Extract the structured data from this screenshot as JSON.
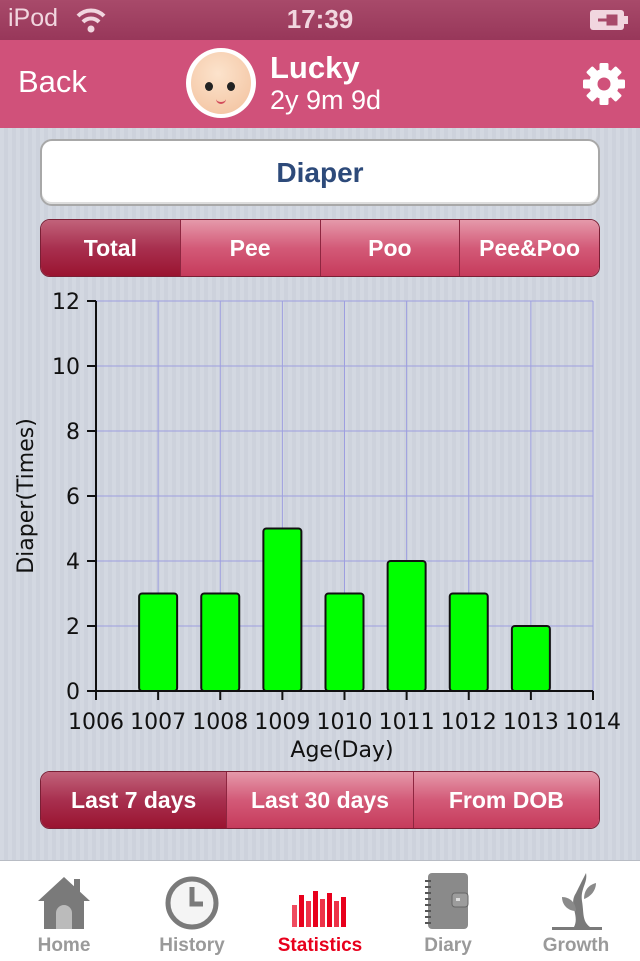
{
  "status_bar": {
    "carrier": "iPod",
    "time": "17:39",
    "wifi_icon": "wifi-icon",
    "battery_icon": "battery-charging-icon"
  },
  "nav": {
    "back_label": "Back",
    "baby_name": "Lucky",
    "baby_age": "2y 9m 9d",
    "avatar_icon": "baby-avatar",
    "settings_icon": "gear-icon"
  },
  "section_title": "Diaper",
  "type_tabs": [
    {
      "label": "Total",
      "active": true
    },
    {
      "label": "Pee",
      "active": false
    },
    {
      "label": "Poo",
      "active": false
    },
    {
      "label": "Pee&Poo",
      "active": false
    }
  ],
  "range_tabs": [
    {
      "label": "Last 7 days",
      "active": true
    },
    {
      "label": "Last 30 days",
      "active": false
    },
    {
      "label": "From DOB",
      "active": false
    }
  ],
  "chart_data": {
    "type": "bar",
    "title": "",
    "xlabel": "Age(Day)",
    "ylabel": "Diaper(Times)",
    "x": [
      1007,
      1008,
      1009,
      1010,
      1011,
      1012,
      1013
    ],
    "values": [
      3,
      3,
      5,
      3,
      4,
      3,
      2
    ],
    "xlim": [
      1006,
      1014
    ],
    "ylim": [
      0,
      12
    ],
    "xticks": [
      1006,
      1007,
      1008,
      1009,
      1010,
      1011,
      1012,
      1013,
      1014
    ],
    "yticks": [
      0,
      2,
      4,
      6,
      8,
      10,
      12
    ],
    "grid": true,
    "bar_color": "#00ff00",
    "grid_color": "#9d9ee0"
  },
  "tab_bar": [
    {
      "label": "Home",
      "icon": "home-icon",
      "active": false
    },
    {
      "label": "History",
      "icon": "clock-icon",
      "active": false
    },
    {
      "label": "Statistics",
      "icon": "statistics-icon",
      "active": true
    },
    {
      "label": "Diary",
      "icon": "diary-icon",
      "active": false
    },
    {
      "label": "Growth",
      "icon": "growth-icon",
      "active": false
    }
  ],
  "colors": {
    "nav": "#d0517a",
    "active_tab": "#e8001c",
    "title_text": "#2d4a7a"
  }
}
